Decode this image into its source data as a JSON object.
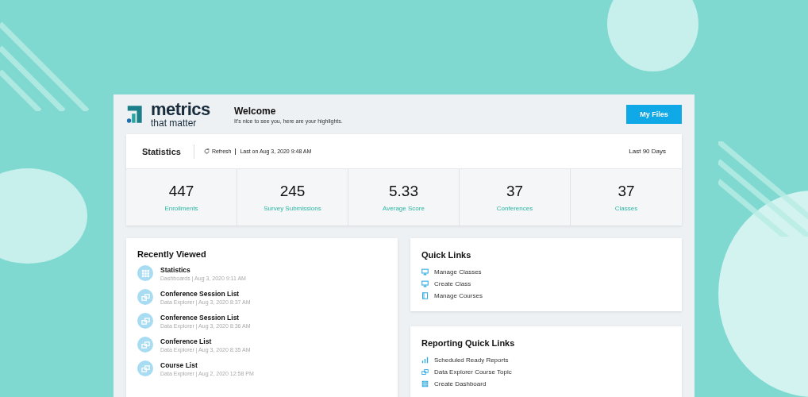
{
  "logo": {
    "name": "metrics",
    "tagline": "that matter"
  },
  "header": {
    "title": "Welcome",
    "subtitle": "It's nice to see you, here are your highlights.",
    "button": "My Files"
  },
  "statistics": {
    "title": "Statistics",
    "refresh": "Refresh",
    "last_updated": "Last on Aug 3, 2020 9:48 AM",
    "range": "Last 90 Days",
    "metrics": [
      {
        "value": "447",
        "label": "Enrollments"
      },
      {
        "value": "245",
        "label": "Survey Submissions"
      },
      {
        "value": "5.33",
        "label": "Average Score"
      },
      {
        "value": "37",
        "label": "Conferences"
      },
      {
        "value": "37",
        "label": "Classes"
      }
    ]
  },
  "recently_viewed": {
    "title": "Recently Viewed",
    "items": [
      {
        "kind": "dashboard",
        "name": "Statistics",
        "meta": "Dashboards | Aug 3, 2020 9:11 AM"
      },
      {
        "kind": "explorer",
        "name": "Conference Session List",
        "meta": "Data Explorer | Aug 3, 2020 8:37 AM"
      },
      {
        "kind": "explorer",
        "name": "Conference Session List",
        "meta": "Data Explorer | Aug 3, 2020 8:36 AM"
      },
      {
        "kind": "explorer",
        "name": "Conference List",
        "meta": "Data Explorer | Aug 3, 2020 8:35 AM"
      },
      {
        "kind": "explorer",
        "name": "Course List",
        "meta": "Data Explorer | Aug 2, 2020 12:58 PM"
      }
    ]
  },
  "quick_links": {
    "title": "Quick Links",
    "items": [
      {
        "kind": "class",
        "label": "Manage Classes"
      },
      {
        "kind": "class",
        "label": "Create Class"
      },
      {
        "kind": "course",
        "label": "Manage Courses"
      }
    ]
  },
  "reporting_quick_links": {
    "title": "Reporting Quick Links",
    "items": [
      {
        "kind": "report",
        "label": "Scheduled Ready Reports"
      },
      {
        "kind": "explorer",
        "label": "Data Explorer Course Topic"
      },
      {
        "kind": "dashboard",
        "label": "Create Dashboard"
      }
    ]
  }
}
